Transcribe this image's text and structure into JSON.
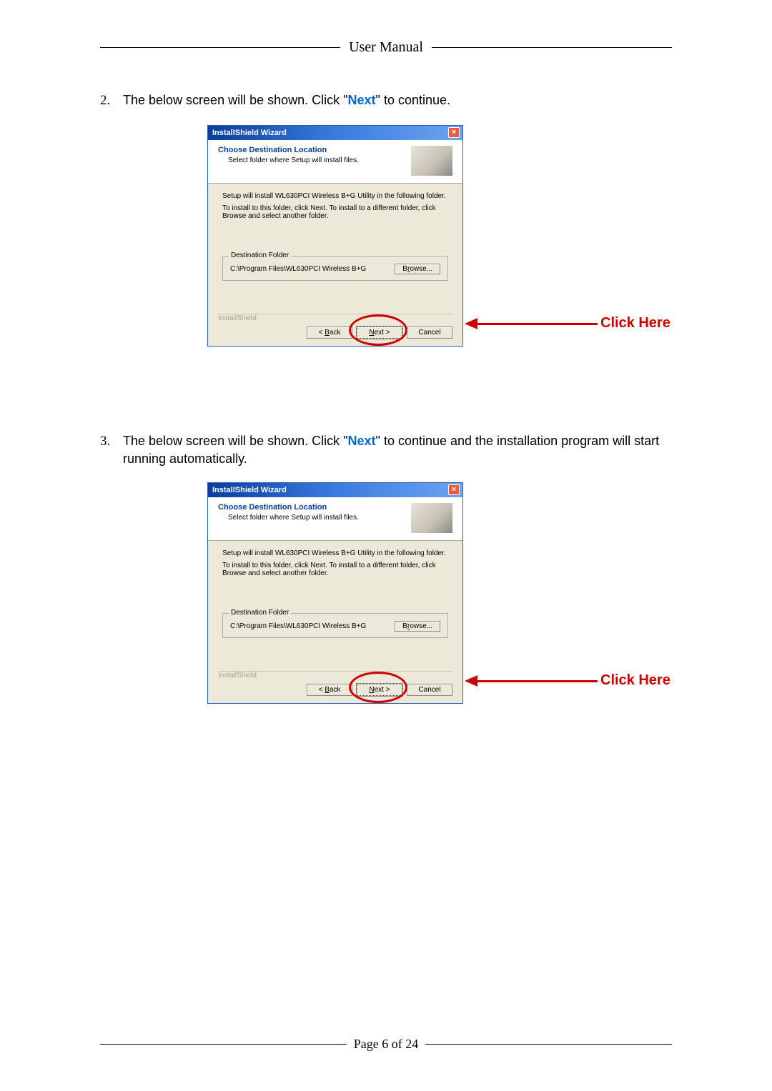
{
  "header": {
    "title": "User Manual"
  },
  "steps": [
    {
      "num": "2.",
      "prefix": "The below screen will be shown. Click \"",
      "highlight": "Next",
      "suffix": "\" to continue."
    },
    {
      "num": "3.",
      "prefix": "The below screen will be shown. Click \"",
      "highlight": "Next",
      "suffix": "\" to continue and the installation program will start running automatically."
    }
  ],
  "wizard": {
    "title": "InstallShield Wizard",
    "heading": "Choose Destination Location",
    "sub": "Select folder where Setup will install files.",
    "line1": "Setup will install WL630PCI Wireless B+G Utility in the following folder.",
    "line2": "To install to this folder, click Next. To install to a different folder, click Browse and select another folder.",
    "dest_legend": "Destination Folder",
    "dest_path": "C:\\Program Files\\WL630PCI Wireless B+G",
    "browse": "Browse...",
    "brand": "InstallShield",
    "back": "< Back",
    "next": "Next >",
    "cancel": "Cancel"
  },
  "annotation": {
    "click_here": "Click Here"
  },
  "footer": {
    "text": "Page 6 of 24"
  }
}
